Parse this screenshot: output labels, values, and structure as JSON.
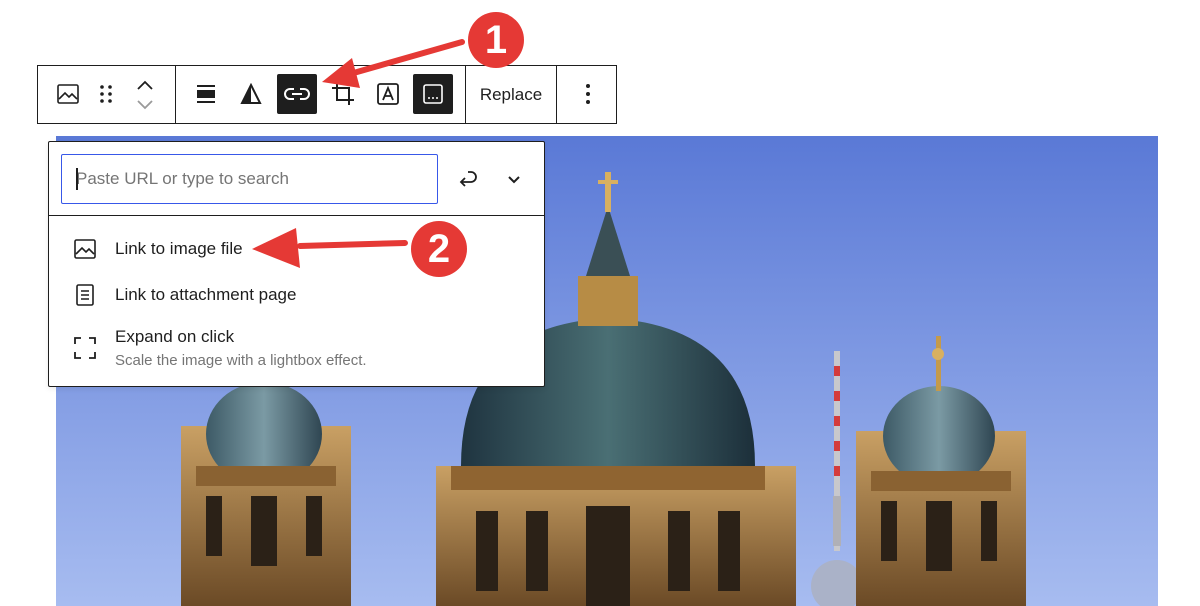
{
  "toolbar": {
    "buttons": [
      {
        "icon": "image-icon",
        "label": ""
      },
      {
        "icon": "drag-handle-icon",
        "label": ""
      },
      {
        "icon": "move-up-icon",
        "label": ""
      },
      {
        "icon": "move-down-icon",
        "label": ""
      },
      {
        "icon": "align-icon",
        "label": ""
      },
      {
        "icon": "duotone-filter-icon",
        "label": ""
      },
      {
        "icon": "link-icon",
        "label": "",
        "active": true
      },
      {
        "icon": "crop-icon",
        "label": ""
      },
      {
        "icon": "text-overlay-icon",
        "label": ""
      },
      {
        "icon": "caption-icon",
        "label": "",
        "active": true
      },
      {
        "icon": "more-options-icon",
        "label": ""
      }
    ],
    "replace_label": "Replace"
  },
  "link_popover": {
    "url_input": {
      "placeholder": "Paste URL or type to search",
      "value": ""
    },
    "submit_icon": "enter-return-icon",
    "settings_toggle_icon": "chevron-down-icon",
    "options": [
      {
        "icon": "image-icon",
        "label": "Link to image file"
      },
      {
        "icon": "page-icon",
        "label": "Link to attachment page"
      },
      {
        "icon": "fullscreen-icon",
        "label": "Expand on click",
        "help": "Scale the image with a lightbox effect."
      }
    ]
  },
  "annotations": {
    "step1": "1",
    "step2": "2",
    "color": "#e53935"
  },
  "colors": {
    "toolbar_active": "#1e1e1e",
    "input_focus": "#3858e9",
    "sky_top": "#5f7fdc",
    "sky_bottom": "#9fb6ef"
  }
}
